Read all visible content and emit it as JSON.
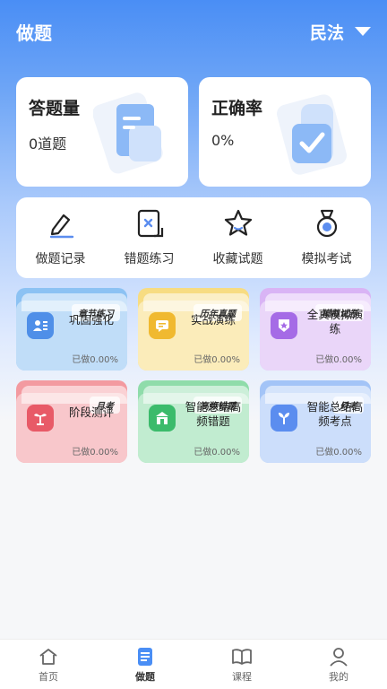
{
  "header": {
    "title": "做题",
    "subject": "民法"
  },
  "stats": [
    {
      "label": "答题量",
      "value": "0道题"
    },
    {
      "label": "正确率",
      "value": "0%"
    }
  ],
  "quick": [
    {
      "label": "做题记录",
      "icon": "pencil-icon"
    },
    {
      "label": "错题练习",
      "icon": "wrong-doc-icon"
    },
    {
      "label": "收藏试题",
      "icon": "star-icon"
    },
    {
      "label": "模拟考试",
      "icon": "medal-icon"
    }
  ],
  "modules": [
    {
      "tag": "章节练习",
      "name": "巩固强化",
      "progress": "已做0.00%",
      "color": "#8cc2f3",
      "icon": "person-list-icon"
    },
    {
      "tag": "历年真题",
      "name": "实战演练",
      "progress": "已做0.00%",
      "color": "#f7dc82",
      "icon": "chat-icon"
    },
    {
      "tag": "模拟试卷",
      "name": "全真模拟演练",
      "progress": "已做0.00%",
      "color": "#d9b4f5",
      "icon": "shield-star-icon"
    },
    {
      "tag": "月考",
      "name": "阶段测评",
      "progress": "已做0.00%",
      "color": "#f39aa0",
      "icon": "plant-icon"
    },
    {
      "tag": "高频错题",
      "name": "智能总结高频错题",
      "progress": "已做0.00%",
      "color": "#8fdcaa",
      "icon": "building-icon"
    },
    {
      "tag": "月考",
      "name": "智能总结高频考点",
      "progress": "已做0.00%",
      "color": "#a3c4f7",
      "icon": "sprout-icon"
    }
  ],
  "tabs": [
    {
      "label": "首页",
      "icon": "home-icon"
    },
    {
      "label": "做题",
      "icon": "practice-icon"
    },
    {
      "label": "课程",
      "icon": "book-icon"
    },
    {
      "label": "我的",
      "icon": "user-icon"
    }
  ],
  "colors": {
    "primary": "#4a8ef5"
  }
}
